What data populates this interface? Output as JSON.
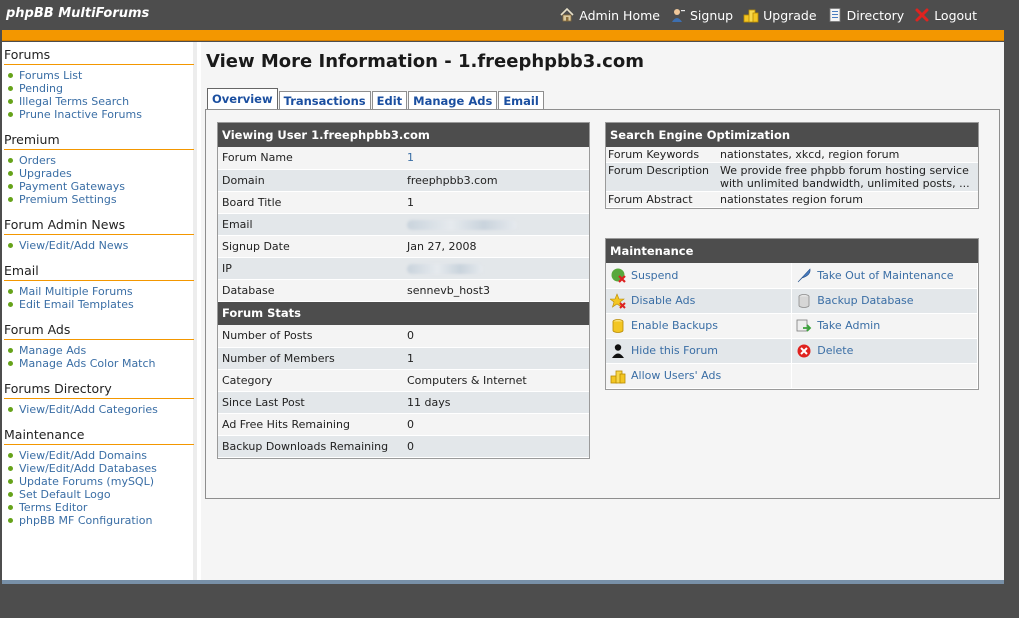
{
  "header": {
    "brand": "phpBB MultiForums",
    "nav": [
      {
        "label": "Admin Home",
        "icon": "home-icon"
      },
      {
        "label": "Signup",
        "icon": "user-add-icon"
      },
      {
        "label": "Upgrade",
        "icon": "coins-icon"
      },
      {
        "label": "Directory",
        "icon": "directory-icon"
      },
      {
        "label": "Logout",
        "icon": "logout-x-icon"
      }
    ]
  },
  "colors": {
    "accent": "#f39700",
    "header_bg": "#4d4d4d",
    "link": "#3a6ea5",
    "tab_text": "#1b4fa0",
    "bullet": "#66a31a"
  },
  "sidebar": {
    "sections": [
      {
        "title": "Forums",
        "items": [
          "Forums List",
          "Pending",
          "Illegal Terms Search",
          "Prune Inactive Forums"
        ]
      },
      {
        "title": "Premium",
        "items": [
          "Orders",
          "Upgrades",
          "Payment Gateways",
          "Premium Settings"
        ]
      },
      {
        "title": "Forum Admin News",
        "items": [
          "View/Edit/Add News"
        ]
      },
      {
        "title": "Email",
        "items": [
          "Mail Multiple Forums",
          "Edit Email Templates"
        ]
      },
      {
        "title": "Forum Ads",
        "items": [
          "Manage Ads",
          "Manage Ads Color Match"
        ]
      },
      {
        "title": "Forums Directory",
        "items": [
          "View/Edit/Add Categories"
        ]
      },
      {
        "title": "Maintenance",
        "items": [
          "View/Edit/Add Domains",
          "View/Edit/Add Databases",
          "Update Forums (mySQL)",
          "Set Default Logo",
          "Terms Editor",
          "phpBB MF Configuration"
        ]
      }
    ]
  },
  "main": {
    "title": "View More Information - 1.freephpbb3.com",
    "tabs": [
      "Overview",
      "Transactions",
      "Edit",
      "Manage Ads",
      "Email"
    ],
    "active_tab": "Overview",
    "user_box": {
      "title": "Viewing User 1.freephpbb3.com",
      "rows": [
        {
          "key": "Forum Name",
          "value": "1"
        },
        {
          "key": "Domain",
          "value": "freephpbb3.com"
        },
        {
          "key": "Board Title",
          "value": "1"
        },
        {
          "key": "Email",
          "value": ""
        },
        {
          "key": "Signup Date",
          "value": "Jan 27, 2008"
        },
        {
          "key": "IP",
          "value": ""
        },
        {
          "key": "Database",
          "value": "sennevb_host3"
        }
      ]
    },
    "stats_box": {
      "title": "Forum Stats",
      "rows": [
        {
          "key": "Number of Posts",
          "value": "0"
        },
        {
          "key": "Number of Members",
          "value": "1"
        },
        {
          "key": "Category",
          "value": "Computers & Internet"
        },
        {
          "key": "Since Last Post",
          "value": "11 days"
        },
        {
          "key": "Ad Free Hits Remaining",
          "value": "0"
        },
        {
          "key": "Backup Downloads Remaining",
          "value": "0"
        }
      ]
    },
    "seo_box": {
      "title": "Search Engine Optimization",
      "rows": [
        {
          "key": "Forum Keywords",
          "value": "nationstates, xkcd, region forum"
        },
        {
          "key": "Forum Description",
          "value": "We provide free phpbb forum hosting service with unlimited bandwidth, unlimited posts, ..."
        },
        {
          "key": "Forum Abstract",
          "value": "nationstates region forum"
        }
      ]
    },
    "maintenance_box": {
      "title": "Maintenance",
      "actions": [
        {
          "label": "Suspend",
          "icon": "suspend-icon"
        },
        {
          "label": "Take Out of Maintenance",
          "icon": "feather-icon"
        },
        {
          "label": "Disable Ads",
          "icon": "disable-ads-icon"
        },
        {
          "label": "Backup Database",
          "icon": "database-icon"
        },
        {
          "label": "Enable Backups",
          "icon": "backup-cylinder-icon"
        },
        {
          "label": "Take Admin",
          "icon": "take-admin-icon"
        },
        {
          "label": "Hide this Forum",
          "icon": "hide-user-icon"
        },
        {
          "label": "Delete",
          "icon": "delete-icon"
        },
        {
          "label": "Allow Users' Ads",
          "icon": "allow-ads-icon"
        }
      ]
    }
  }
}
